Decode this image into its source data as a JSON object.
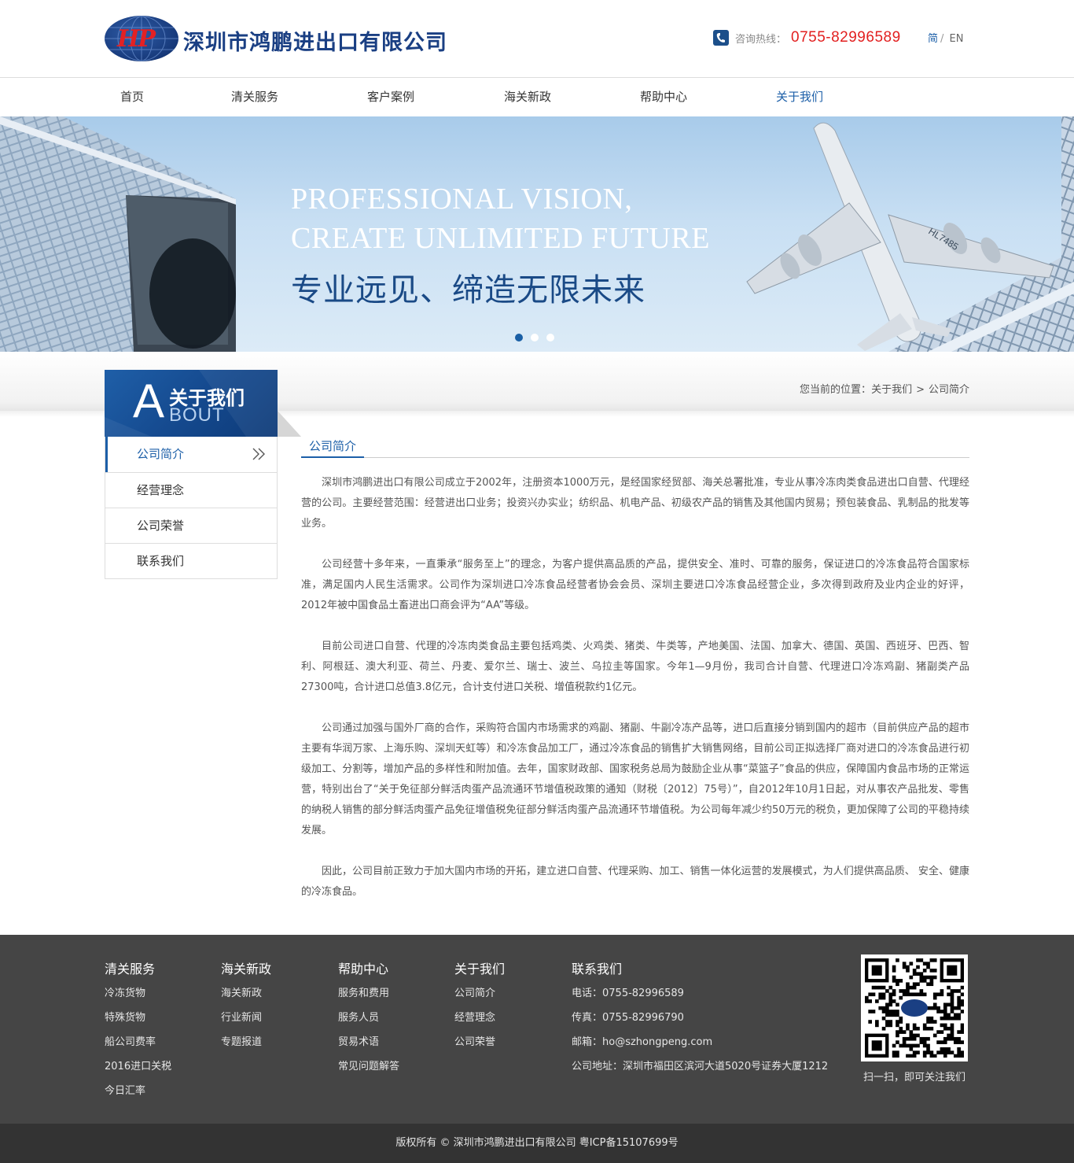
{
  "header": {
    "company_name": "深圳市鸿鹏进出口有限公司",
    "logo_mark": "HP",
    "hotline_label": "咨询热线：",
    "hotline_number": "0755-82996589",
    "lang_cn": "简",
    "lang_sep": "/",
    "lang_en": "EN"
  },
  "nav": {
    "items": [
      {
        "label": "首页"
      },
      {
        "label": "清关服务"
      },
      {
        "label": "客户案例"
      },
      {
        "label": "海关新政"
      },
      {
        "label": "帮助中心"
      },
      {
        "label": "关于我们",
        "active": true
      }
    ]
  },
  "banner": {
    "title_en_line1": "PROFESSIONAL VISION,",
    "title_en_line2": "CREATE UNLIMITED FUTURE",
    "title_cn": "专业远见、缔造无限未来",
    "plane_reg": "HL7485",
    "slide_count": 3,
    "active_slide": 1
  },
  "sidebar": {
    "head_letter": "A",
    "head_title": "关于我们",
    "head_en": "BOUT",
    "items": [
      {
        "label": "公司简介",
        "active": true
      },
      {
        "label": "经营理念"
      },
      {
        "label": "公司荣誉"
      },
      {
        "label": "联系我们"
      }
    ]
  },
  "breadcrumb": {
    "prefix": "您当前的位置：",
    "level1": "关于我们",
    "separator": ">",
    "level2": "公司简介"
  },
  "main": {
    "section_title": "公司简介",
    "paragraphs": [
      "深圳市鸿鹏进出口有限公司成立于2002年，注册资本1000万元，是经国家经贸部、海关总署批准，专业从事冷冻肉类食品进出口自营、代理经营的公司。主要经营范围：经营进出口业务；投资兴办实业；纺织品、机电产品、初级农产品的销售及其他国内贸易；预包装食品、乳制品的批发等业务。",
      "公司经营十多年来，一直秉承“服务至上”的理念，为客户提供高品质的产品，提供安全、准时、可靠的服务，保证进口的冷冻食品符合国家标准，满足国内人民生活需求。公司作为深圳进口冷冻食品经营者协会会员、深圳主要进口冷冻食品经营企业，多次得到政府及业内企业的好评，2012年被中国食品土畜进出口商会评为“AA”等级。",
      "目前公司进口自营、代理的冷冻肉类食品主要包括鸡类、火鸡类、猪类、牛类等，产地美国、法国、加拿大、德国、英国、西班牙、巴西、智利、阿根廷、澳大利亚、荷兰、丹麦、爱尔兰、瑞士、波兰、乌拉圭等国家。今年1—9月份，我司合计自营、代理进口冷冻鸡副、猪副类产品27300吨，合计进口总值3.8亿元，合计支付进口关税、增值税款约1亿元。",
      "公司通过加强与国外厂商的合作，采购符合国内市场需求的鸡副、猪副、牛副冷冻产品等，进口后直接分销到国内的超市（目前供应产品的超市主要有华润万家、上海乐购、深圳天虹等）和冷冻食品加工厂，通过冷冻食品的销售扩大销售网络，目前公司正拟选择厂商对进口的冷冻食品进行初级加工、分割等，增加产品的多样性和附加值。去年，国家财政部、国家税务总局为鼓励企业从事“菜篮子”食品的供应，保障国内食品市场的正常运营，特别出台了“关于免征部分鲜活肉蛋产品流通环节增值税政策的通知（财税〔2012〕75号）”，自2012年10月1日起，对从事农产品批发、零售的纳税人销售的部分鲜活肉蛋产品免征增值税免征部分鲜活肉蛋产品流通环节增值税。为公司每年减少约50万元的税负，更加保障了公司的平稳持续发展。",
      "因此，公司目前正致力于加大国内市场的开拓，建立进口自营、代理采购、加工、销售一体化运营的发展模式，为人们提供高品质、 安全、健康的冷冻食品。"
    ]
  },
  "footer": {
    "columns": [
      {
        "title": "清关服务",
        "links": [
          "冷冻货物",
          "特殊货物",
          "船公司费率",
          "2016进口关税",
          "今日汇率"
        ]
      },
      {
        "title": "海关新政",
        "links": [
          "海关新政",
          "行业新闻",
          "专题报道"
        ]
      },
      {
        "title": "帮助中心",
        "links": [
          "服务和费用",
          "服务人员",
          "贸易术语",
          "常见问题解答"
        ]
      },
      {
        "title": "关于我们",
        "links": [
          "公司简介",
          "经营理念",
          "公司荣誉"
        ]
      },
      {
        "title": "联系我们",
        "links": [
          "电话：0755-82996589",
          "传真：0755-82996790",
          "邮箱：ho@szhongpeng.com",
          "公司地址：深圳市福田区滨河大道5020号证券大厦1212"
        ]
      }
    ],
    "qr_caption": "扫一扫，即可关注我们",
    "copyright": "版权所有 © 深圳市鸿鹏进出口有限公司 粤ICP备15107699号"
  },
  "colors": {
    "brand_blue": "#1c5fa8",
    "hotline_red": "#e21f1f",
    "footer_bg": "#454545",
    "copyright_bg": "#333333"
  }
}
